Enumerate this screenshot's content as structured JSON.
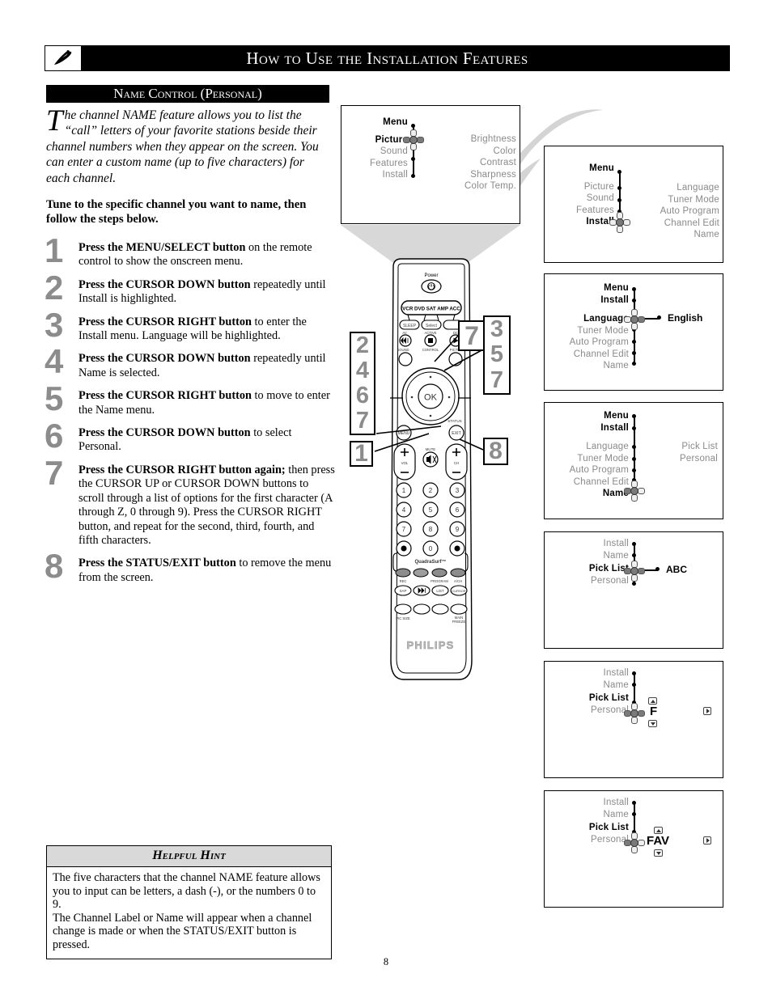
{
  "header": {
    "title": "How to Use the Installation Features",
    "logo_icon": "philips-shield-icon"
  },
  "section": {
    "title": "Name Control (Personal)"
  },
  "intro": {
    "dropcap": "T",
    "text": "he channel NAME feature allows you to list the “call” letters of your favorite stations beside their channel numbers when they appear on the screen.  You can  enter a custom name (up to five characters) for each channel.",
    "subhead": "Tune to the specific channel you want to name, then follow the steps below."
  },
  "steps": [
    {
      "num": "1",
      "bold": "Press the MENU/SELECT button",
      "rest": " on the remote control to show the onscreen menu."
    },
    {
      "num": "2",
      "bold": "Press the CURSOR DOWN button",
      "rest": " repeatedly until Install is highlighted."
    },
    {
      "num": "3",
      "bold": "Press the CURSOR RIGHT button",
      "rest": " to enter the Install menu. Language will be highlighted."
    },
    {
      "num": "4",
      "bold": "Press the CURSOR DOWN button",
      "rest": " repeatedly until Name is selected."
    },
    {
      "num": "5",
      "bold": "Press the CURSOR RIGHT button",
      "rest": " to move to enter the Name menu."
    },
    {
      "num": "6",
      "bold": "Press the CURSOR DOWN button",
      "rest": " to select Personal."
    },
    {
      "num": "7",
      "bold": "Press the CURSOR RIGHT button again;",
      "rest": " then press the CURSOR UP or CURSOR DOWN buttons to scroll through a list of options for the first character (A through Z, 0 through 9).  Press the CURSOR RIGHT button, and repeat for the second, third, fourth, and fifth characters."
    },
    {
      "num": "8",
      "bold": "Press the STATUS/EXIT button",
      "rest": " to remove the menu from the screen."
    }
  ],
  "hint": {
    "heading": "Helpful Hint",
    "body": "The five characters that the channel NAME feature allows you to input can be letters, a dash (-), or the numbers 0 to 9.\nThe Channel Label or Name will appear when a channel change is made or when the STATUS/EXIT button is pressed."
  },
  "page_number": "8",
  "screens": {
    "main": {
      "name": "main-menu-screen",
      "title": "Menu",
      "left_items": [
        "Picture",
        "Sound",
        "Features",
        "Install"
      ],
      "highlighted": "Picture",
      "right_items": [
        "Brightness",
        "Color",
        "Contrast",
        "Sharpness",
        "Color Temp."
      ]
    },
    "s1": {
      "name": "install-highlighted-screen",
      "title": "Menu",
      "left_items": [
        "Picture",
        "Sound",
        "Features",
        "Install"
      ],
      "highlighted": "Install",
      "right_items": [
        "Language",
        "Tuner Mode",
        "Auto Program",
        "Channel Edit",
        "Name"
      ]
    },
    "s2": {
      "name": "language-screen",
      "breadcrumb": [
        "Menu",
        "Install"
      ],
      "left_items": [
        "Language",
        "Tuner Mode",
        "Auto Program",
        "Channel Edit",
        "Name"
      ],
      "highlighted": "Language",
      "value": "English"
    },
    "s3": {
      "name": "name-selected-screen",
      "breadcrumb": [
        "Menu",
        "Install"
      ],
      "left_items": [
        "Language",
        "Tuner Mode",
        "Auto Program",
        "Channel Edit",
        "Name"
      ],
      "highlighted": "Name",
      "right_items": [
        "Pick List",
        "Personal"
      ]
    },
    "s4": {
      "name": "pick-list-screen",
      "breadcrumb": [
        "Install",
        "Name"
      ],
      "left_items": [
        "Pick List",
        "Personal"
      ],
      "highlighted": "Pick List",
      "value": "ABC"
    },
    "s5": {
      "name": "personal-first-character-screen",
      "breadcrumb": [
        "Install",
        "Name"
      ],
      "left_items": [
        "Pick List",
        "Personal"
      ],
      "highlighted": "Personal",
      "value": "F",
      "up_icon": "cursor-up-icon",
      "down_icon": "cursor-down-icon",
      "right_icon": "cursor-right-icon"
    },
    "s6": {
      "name": "personal-fav-screen",
      "breadcrumb": [
        "Install",
        "Name"
      ],
      "left_items": [
        "Pick List",
        "Personal"
      ],
      "highlighted": "Personal",
      "value": "FAV",
      "up_icon": "cursor-up-icon",
      "down_icon": "cursor-down-icon",
      "right_icon": "cursor-right-icon"
    }
  },
  "callouts": {
    "one": "1",
    "stack_left": [
      "2",
      "4",
      "6",
      "7"
    ],
    "seven": "7",
    "stack_right": [
      "3",
      "5",
      "7"
    ],
    "eight": "8"
  },
  "remote": {
    "brand": "PHILIPS",
    "power_label": "Power",
    "device_bar": "VCR DVD SAT AMP ACC",
    "sleep": "SLEEP",
    "select": "Select",
    "row_labels": [
      "AV",
      "ACTIVE",
      "DC"
    ],
    "control_label": "CONTROL",
    "sound_label": "SOUND",
    "picture_label": "PICTURE",
    "ok": "OK",
    "menu": "MENU",
    "exit": "EXIT",
    "status": "STATUS",
    "vol": "VOL",
    "ch": "CH",
    "mute": "MUTE",
    "keypad": [
      "1",
      "2",
      "3",
      "4",
      "5",
      "6",
      "7",
      "8",
      "9",
      "0"
    ],
    "quadrasurf": "QuadraSurf™",
    "fn_labels": [
      "REC",
      "PROGRAM",
      "A/CH"
    ],
    "fn_row2": [
      "SAP",
      "",
      "LIST",
      "CURSOR"
    ],
    "fn_row3_left": "PIC SIZE",
    "fn_row3_right": "MAIN FREEZE"
  }
}
